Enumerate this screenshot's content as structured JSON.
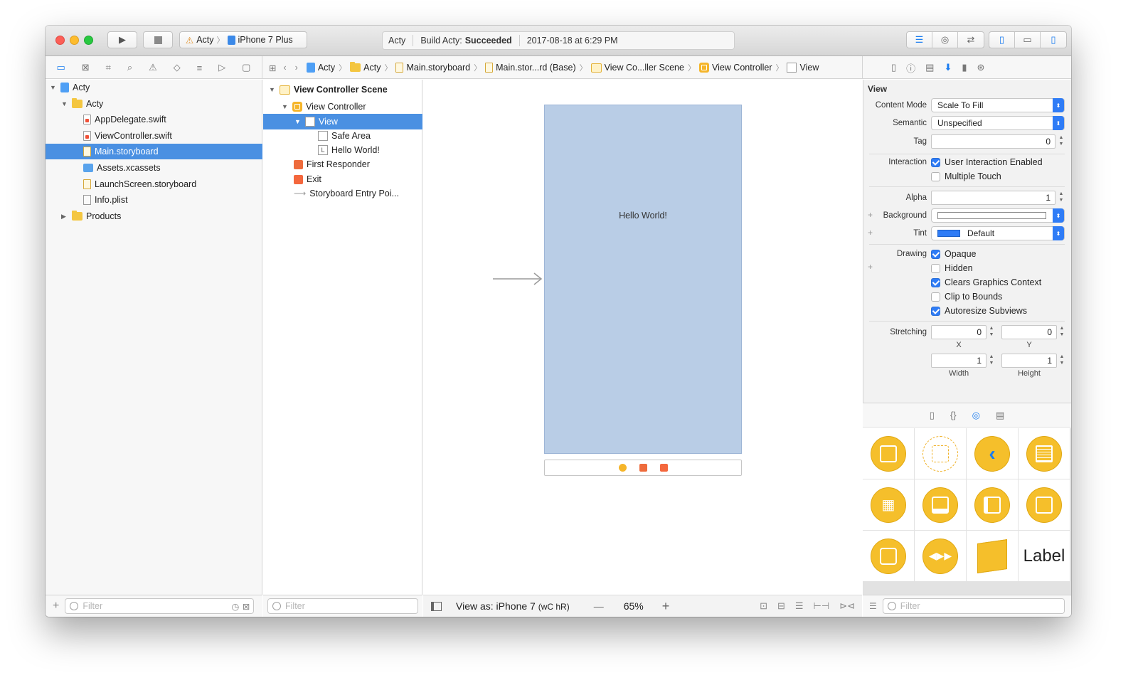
{
  "toolbar": {
    "scheme_target": "Acty",
    "scheme_device": "iPhone 7 Plus",
    "activity_project": "Acty",
    "activity_status_prefix": "Build Acty:",
    "activity_status": "Succeeded",
    "activity_time": "2017-08-18 at 6:29 PM"
  },
  "jumpbar": {
    "crumbs": [
      "Acty",
      "Acty",
      "Main.storyboard",
      "Main.stor...rd (Base)",
      "View Co...ller Scene",
      "View Controller",
      "View"
    ]
  },
  "navigator": {
    "items": [
      {
        "label": "Acty",
        "kind": "project"
      },
      {
        "label": "Acty",
        "kind": "folder"
      },
      {
        "label": "AppDelegate.swift",
        "kind": "swift"
      },
      {
        "label": "ViewController.swift",
        "kind": "swift"
      },
      {
        "label": "Main.storyboard",
        "kind": "storyboard"
      },
      {
        "label": "Assets.xcassets",
        "kind": "assets"
      },
      {
        "label": "LaunchScreen.storyboard",
        "kind": "storyboard"
      },
      {
        "label": "Info.plist",
        "kind": "plist"
      },
      {
        "label": "Products",
        "kind": "folder"
      }
    ],
    "filter_placeholder": "Filter"
  },
  "outline": {
    "items": [
      {
        "label": "View Controller Scene"
      },
      {
        "label": "View Controller"
      },
      {
        "label": "View"
      },
      {
        "label": "Safe Area"
      },
      {
        "label": "Hello World!"
      },
      {
        "label": "First Responder"
      },
      {
        "label": "Exit"
      },
      {
        "label": "Storyboard Entry Poi..."
      }
    ],
    "filter_placeholder": "Filter"
  },
  "canvas": {
    "hello_label": "Hello World!",
    "view_as": "View as: iPhone 7",
    "size_class": "(wC hR)",
    "zoom_minus": "—",
    "zoom": "65%",
    "zoom_plus": "+"
  },
  "inspector": {
    "section_title": "View",
    "content_mode_label": "Content Mode",
    "content_mode_value": "Scale To Fill",
    "semantic_label": "Semantic",
    "semantic_value": "Unspecified",
    "tag_label": "Tag",
    "tag_value": "0",
    "interaction_label": "Interaction",
    "user_interaction": "User Interaction Enabled",
    "multiple_touch": "Multiple Touch",
    "alpha_label": "Alpha",
    "alpha_value": "1",
    "background_label": "Background",
    "tint_label": "Tint",
    "tint_value": "Default",
    "tint_color": "#2f7cf6",
    "drawing_label": "Drawing",
    "opaque": "Opaque",
    "hidden": "Hidden",
    "clears_graphics": "Clears Graphics Context",
    "clip_to_bounds": "Clip to Bounds",
    "autoresize": "Autoresize Subviews",
    "stretching_label": "Stretching",
    "stretch_x": "0",
    "stretch_y": "0",
    "stretch_w": "1",
    "stretch_h": "1",
    "x_label": "X",
    "y_label": "Y",
    "width_label": "Width",
    "height_label": "Height"
  },
  "library": {
    "label_item": "Label",
    "filter_placeholder": "Filter"
  }
}
